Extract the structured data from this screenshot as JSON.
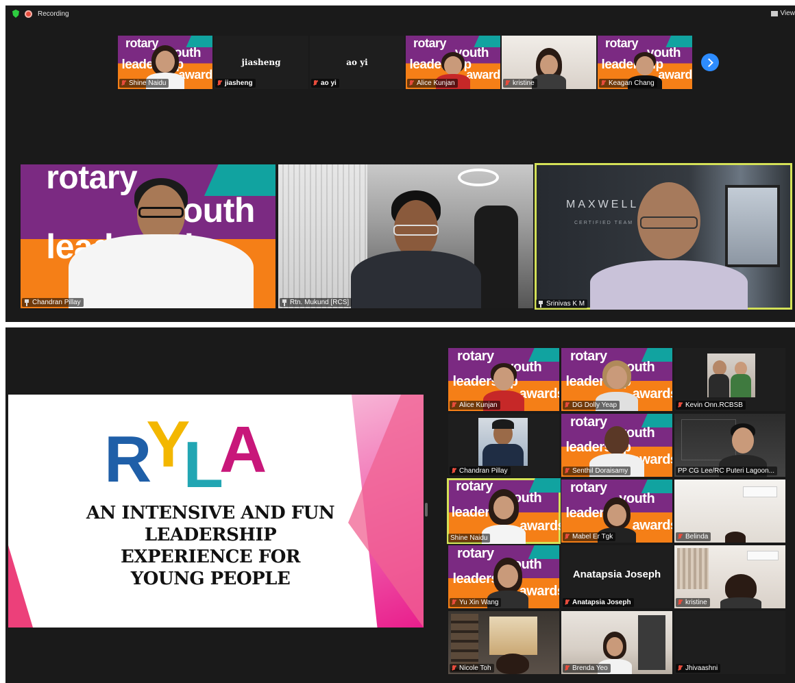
{
  "top_bar": {
    "recording_label": "Recording",
    "view_label": "View"
  },
  "top_strip": [
    {
      "name": "Shine Naidu",
      "bg": "rotary",
      "mic_muted": true
    },
    {
      "name": "jiasheng",
      "display": "jiasheng",
      "bg": "name",
      "mic_muted": true
    },
    {
      "name": "ao yi",
      "display": "ao yi",
      "bg": "name",
      "mic_muted": true
    },
    {
      "name": "Alice Kunjan",
      "bg": "rotary",
      "mic_muted": true
    },
    {
      "name": "kristine",
      "bg": "room",
      "mic_muted": true
    },
    {
      "name": "Keagan Chang",
      "bg": "rotary",
      "mic_muted": true
    }
  ],
  "rotary_text": {
    "w1": "rotary",
    "w2": "youth",
    "w3": "leadership",
    "w4": "awards"
  },
  "speakers": [
    {
      "name": "Chandran Pillay",
      "pinned": true
    },
    {
      "name": "Rtn. Mukund [RCS]",
      "pinned": true
    },
    {
      "name": "Srinivas K M",
      "pinned": true,
      "active": true,
      "backdrop_text": "MAXWELL",
      "backdrop_sub": "CERTIFIED TEAM"
    }
  ],
  "slide": {
    "letters": [
      "R",
      "Y",
      "L",
      "A"
    ],
    "lines": [
      "AN INTENSIVE AND FUN",
      "LEADERSHIP",
      "EXPERIENCE FOR",
      "YOUNG PEOPLE"
    ]
  },
  "gallery": [
    {
      "name": "Alice Kunjan",
      "bg": "rotary"
    },
    {
      "name": "DG Dolly Yeap",
      "bg": "rotary"
    },
    {
      "name": "Kevin Onn.RCBSB",
      "bg": "photo"
    },
    {
      "name": "Chandran Pillay",
      "bg": "photo-dark"
    },
    {
      "name": "Senthil Doraisamy",
      "bg": "rotary"
    },
    {
      "name": "PP CG Lee/RC Puteri Lagoon...",
      "bg": "office"
    },
    {
      "name": "Shine Naidu",
      "bg": "rotary",
      "active": true
    },
    {
      "name": "Mabel Er Tgk",
      "bg": "rotary"
    },
    {
      "name": "Belinda",
      "bg": "room"
    },
    {
      "name": "Yu Xin Wang",
      "bg": "rotary"
    },
    {
      "name": "Anatapsia Joseph",
      "display": "Anatapsia Joseph",
      "bg": "name"
    },
    {
      "name": "kristine",
      "bg": "room"
    },
    {
      "name": "Nicole Toh",
      "bg": "room-dark"
    },
    {
      "name": "Brenda Yeo",
      "bg": "room"
    },
    {
      "name": "Jhivaashni",
      "bg": "blank"
    }
  ],
  "colors": {
    "active_border": "#d4e157",
    "next_button": "#2d8cff",
    "muted_mic": "#e74c3c"
  }
}
